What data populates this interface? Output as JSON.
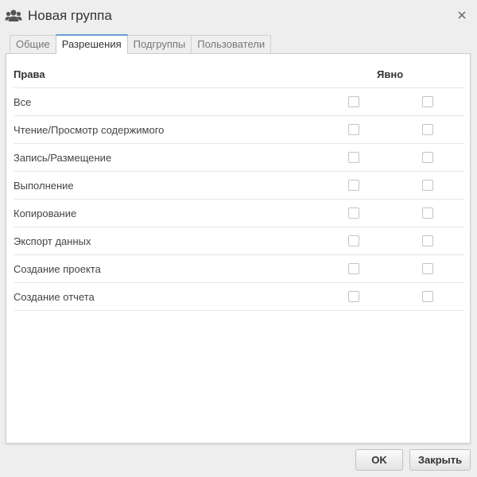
{
  "window": {
    "title": "Новая группа",
    "icon": "group-users-icon",
    "close_icon": "close-icon"
  },
  "tabs": [
    {
      "label": "Общие",
      "active": false
    },
    {
      "label": "Разрешения",
      "active": true
    },
    {
      "label": "Подгруппы",
      "active": false
    },
    {
      "label": "Пользователи",
      "active": false
    }
  ],
  "permissions": {
    "col_rights": "Права",
    "col_explicit": "Явно",
    "rows": [
      {
        "label": "Все",
        "checked1": false,
        "checked2": false
      },
      {
        "label": "Чтение/Просмотр содержимого",
        "checked1": false,
        "checked2": false
      },
      {
        "label": "Запись/Размещение",
        "checked1": false,
        "checked2": false
      },
      {
        "label": "Выполнение",
        "checked1": false,
        "checked2": false
      },
      {
        "label": "Копирование",
        "checked1": false,
        "checked2": false
      },
      {
        "label": "Экспорт данных",
        "checked1": false,
        "checked2": false
      },
      {
        "label": "Создание проекта",
        "checked1": false,
        "checked2": false
      },
      {
        "label": "Создание отчета",
        "checked1": false,
        "checked2": false
      }
    ]
  },
  "footer": {
    "ok_label": "OK",
    "close_label": "Закрыть"
  },
  "colors": {
    "accent_tab": "#6a9fd0",
    "background": "#eeeeee",
    "panel": "#ffffff"
  }
}
